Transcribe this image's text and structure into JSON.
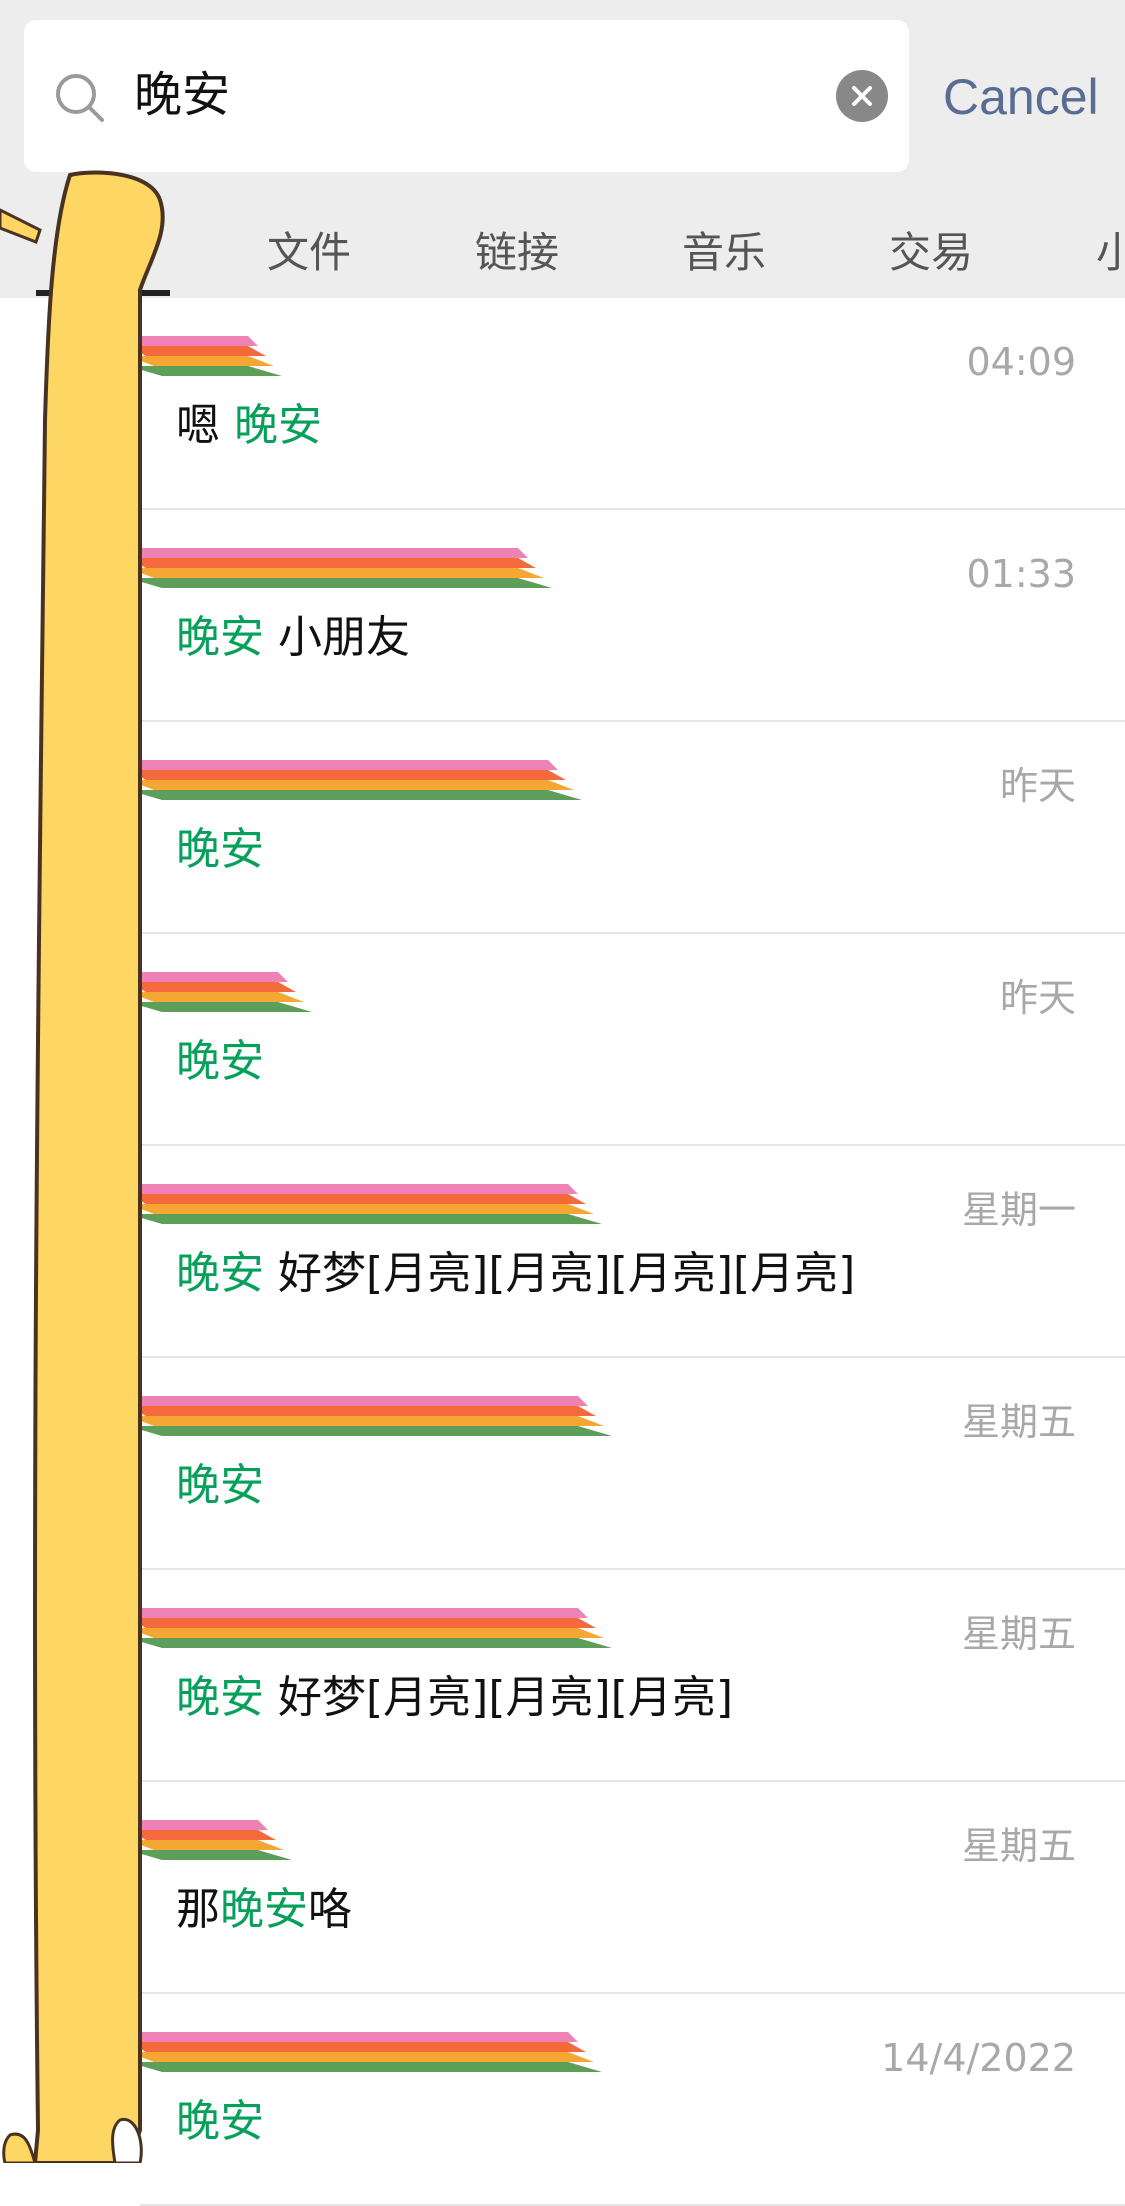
{
  "search": {
    "query": "晚安",
    "cancel_label": "Cancel"
  },
  "tabs": [
    {
      "label": "文件"
    },
    {
      "label": "链接"
    },
    {
      "label": "音乐"
    },
    {
      "label": "交易"
    },
    {
      "label": "小"
    }
  ],
  "results": [
    {
      "time": "04:09",
      "parts": [
        {
          "t": "嗯 "
        },
        {
          "t": "晚安",
          "h": true
        }
      ]
    },
    {
      "time": "01:33",
      "parts": [
        {
          "t": "晚安",
          "h": true
        },
        {
          "t": " 小朋友"
        }
      ]
    },
    {
      "time": "昨天",
      "parts": [
        {
          "t": "晚安",
          "h": true
        }
      ]
    },
    {
      "time": "昨天",
      "parts": [
        {
          "t": "晚安",
          "h": true
        }
      ]
    },
    {
      "time": "星期一",
      "parts": [
        {
          "t": "晚安",
          "h": true
        },
        {
          "t": " 好梦[月亮][月亮][月亮][月亮]"
        }
      ]
    },
    {
      "time": "星期五",
      "parts": [
        {
          "t": "晚安",
          "h": true
        }
      ]
    },
    {
      "time": "星期五",
      "parts": [
        {
          "t": "晚安",
          "h": true
        },
        {
          "t": " 好梦[月亮][月亮][月亮]"
        }
      ]
    },
    {
      "time": "星期五",
      "parts": [
        {
          "t": "那"
        },
        {
          "t": "晚安",
          "h": true
        },
        {
          "t": "咯"
        }
      ]
    },
    {
      "time": "14/4/2022",
      "parts": [
        {
          "t": "晚安",
          "h": true
        }
      ]
    }
  ],
  "colors": {
    "highlight": "#07a05a",
    "cancel": "#586c94",
    "stripe_pink": "#ee82b4",
    "stripe_red": "#f46a3c",
    "stripe_orange": "#f5a733",
    "stripe_green": "#5e9e5b",
    "sticker_yellow": "#fdd663"
  },
  "icons": {
    "search": "search-icon",
    "clear": "clear-icon"
  }
}
